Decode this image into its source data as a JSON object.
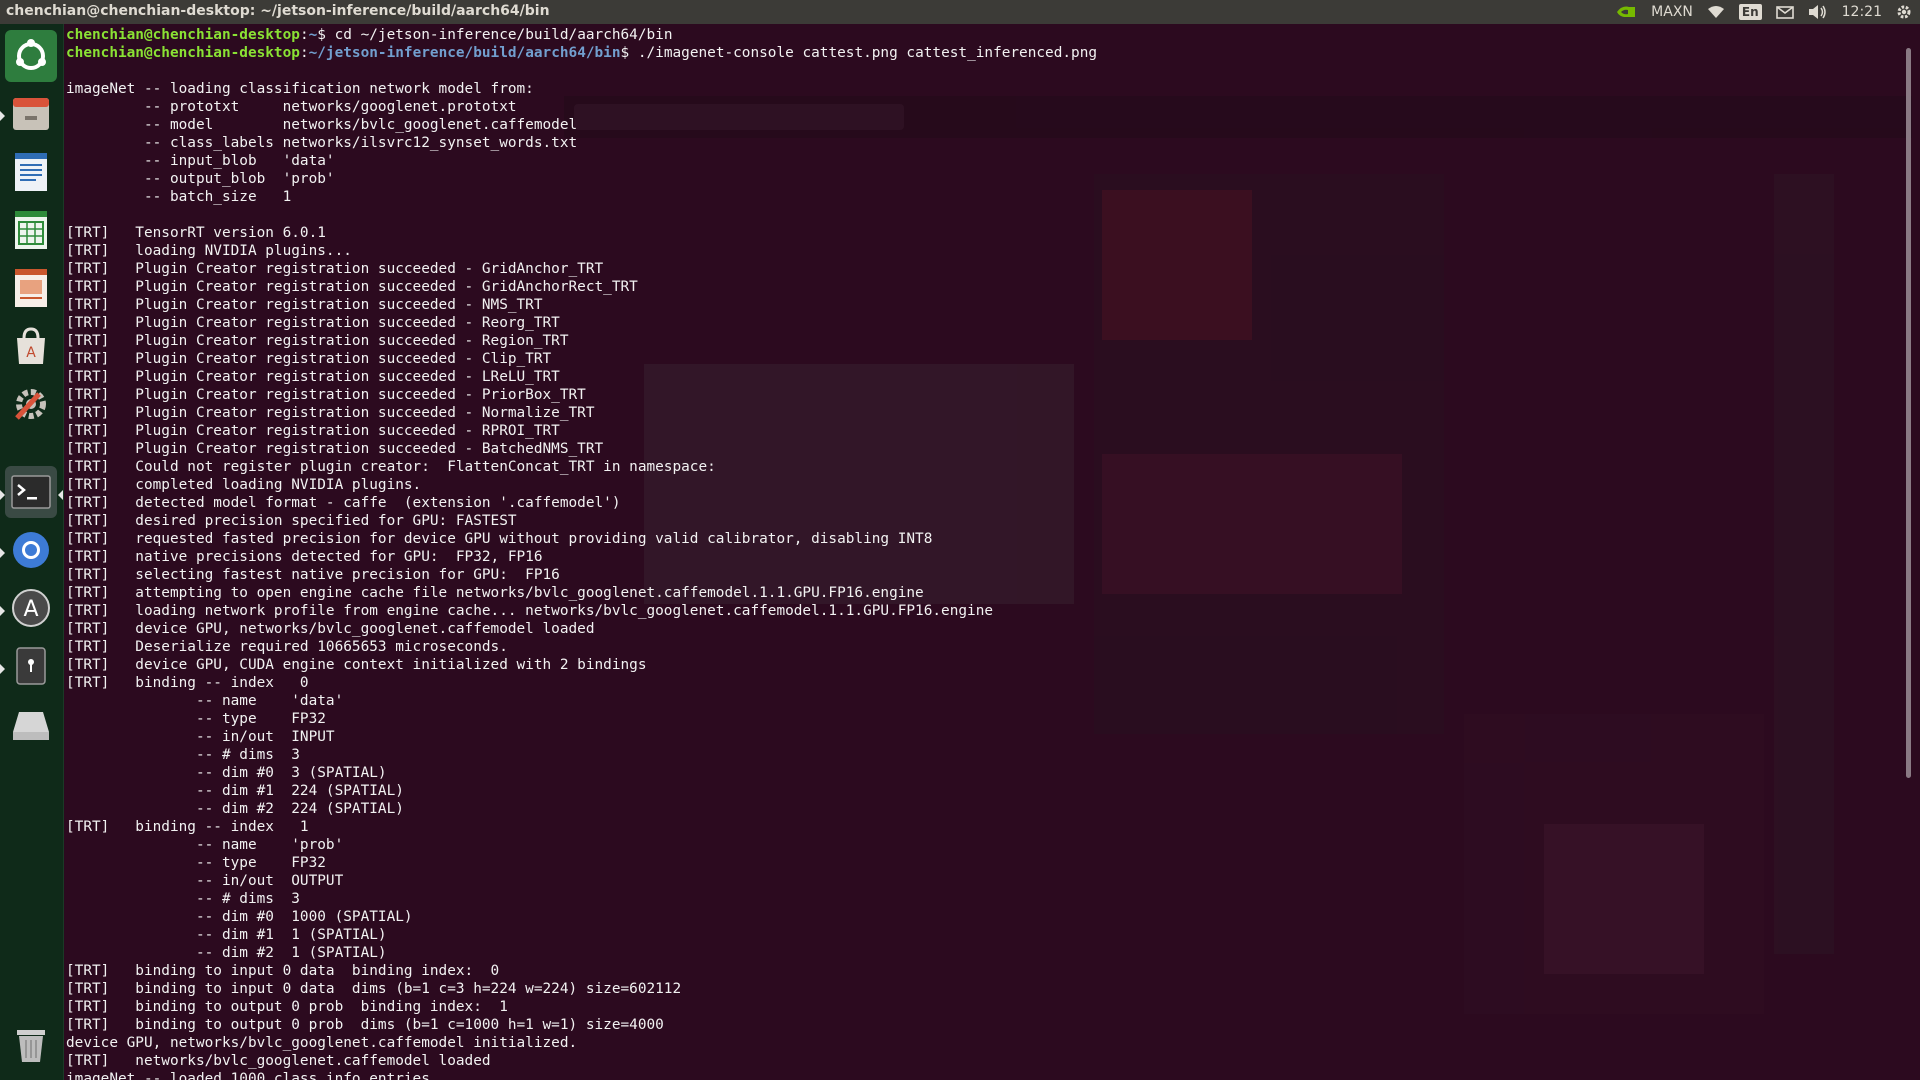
{
  "topbar": {
    "window_title": "chenchian@chenchian-desktop: ~/jetson-inference/build/aarch64/bin",
    "power_mode": "MAXN",
    "language": "En",
    "time": "12:21",
    "icons": [
      "nvidia-icon",
      "wifi-icon",
      "mail-icon",
      "volume-icon",
      "gear-icon"
    ]
  },
  "launcher": {
    "items": [
      {
        "name": "ubuntu-dash",
        "icon": "ubuntu-logo-icon"
      },
      {
        "name": "files",
        "icon": "file-manager-icon"
      },
      {
        "name": "writer",
        "icon": "writer-document-icon"
      },
      {
        "name": "calc",
        "icon": "spreadsheet-icon"
      },
      {
        "name": "impress",
        "icon": "presentation-icon"
      },
      {
        "name": "software",
        "icon": "shopping-bag-icon"
      },
      {
        "name": "settings",
        "icon": "system-settings-icon"
      },
      {
        "name": "terminal",
        "icon": "terminal-icon"
      },
      {
        "name": "chromium",
        "icon": "browser-icon"
      },
      {
        "name": "updater",
        "icon": "software-updater-icon"
      },
      {
        "name": "usb",
        "icon": "usb-drive-icon"
      },
      {
        "name": "drive",
        "icon": "removable-drive-icon"
      },
      {
        "name": "trash",
        "icon": "trash-icon"
      }
    ]
  },
  "terminal": {
    "prompt_user": "chenchian@chenchian-desktop",
    "prompt_sep": ":",
    "prompt_path_1": "~",
    "cmd_1": "$ cd ~/jetson-inference/build/aarch64/bin",
    "prompt_path_2": "~/jetson-inference/build/aarch64/bin",
    "cmd_2": "$ ./imagenet-console cattest.png cattest_inferenced.png",
    "output": [
      "",
      "imageNet -- loading classification network model from:",
      "         -- prototxt     networks/googlenet.prototxt",
      "         -- model        networks/bvlc_googlenet.caffemodel",
      "         -- class_labels networks/ilsvrc12_synset_words.txt",
      "         -- input_blob   'data'",
      "         -- output_blob  'prob'",
      "         -- batch_size   1",
      "",
      "[TRT]   TensorRT version 6.0.1",
      "[TRT]   loading NVIDIA plugins...",
      "[TRT]   Plugin Creator registration succeeded - GridAnchor_TRT",
      "[TRT]   Plugin Creator registration succeeded - GridAnchorRect_TRT",
      "[TRT]   Plugin Creator registration succeeded - NMS_TRT",
      "[TRT]   Plugin Creator registration succeeded - Reorg_TRT",
      "[TRT]   Plugin Creator registration succeeded - Region_TRT",
      "[TRT]   Plugin Creator registration succeeded - Clip_TRT",
      "[TRT]   Plugin Creator registration succeeded - LReLU_TRT",
      "[TRT]   Plugin Creator registration succeeded - PriorBox_TRT",
      "[TRT]   Plugin Creator registration succeeded - Normalize_TRT",
      "[TRT]   Plugin Creator registration succeeded - RPROI_TRT",
      "[TRT]   Plugin Creator registration succeeded - BatchedNMS_TRT",
      "[TRT]   Could not register plugin creator:  FlattenConcat_TRT in namespace:",
      "[TRT]   completed loading NVIDIA plugins.",
      "[TRT]   detected model format - caffe  (extension '.caffemodel')",
      "[TRT]   desired precision specified for GPU: FASTEST",
      "[TRT]   requested fasted precision for device GPU without providing valid calibrator, disabling INT8",
      "[TRT]   native precisions detected for GPU:  FP32, FP16",
      "[TRT]   selecting fastest native precision for GPU:  FP16",
      "[TRT]   attempting to open engine cache file networks/bvlc_googlenet.caffemodel.1.1.GPU.FP16.engine",
      "[TRT]   loading network profile from engine cache... networks/bvlc_googlenet.caffemodel.1.1.GPU.FP16.engine",
      "[TRT]   device GPU, networks/bvlc_googlenet.caffemodel loaded",
      "[TRT]   Deserialize required 10665653 microseconds.",
      "[TRT]   device GPU, CUDA engine context initialized with 2 bindings",
      "[TRT]   binding -- index   0",
      "               -- name    'data'",
      "               -- type    FP32",
      "               -- in/out  INPUT",
      "               -- # dims  3",
      "               -- dim #0  3 (SPATIAL)",
      "               -- dim #1  224 (SPATIAL)",
      "               -- dim #2  224 (SPATIAL)",
      "[TRT]   binding -- index   1",
      "               -- name    'prob'",
      "               -- type    FP32",
      "               -- in/out  OUTPUT",
      "               -- # dims  3",
      "               -- dim #0  1000 (SPATIAL)",
      "               -- dim #1  1 (SPATIAL)",
      "               -- dim #2  1 (SPATIAL)",
      "[TRT]   binding to input 0 data  binding index:  0",
      "[TRT]   binding to input 0 data  dims (b=1 c=3 h=224 w=224) size=602112",
      "[TRT]   binding to output 0 prob  binding index:  1",
      "[TRT]   binding to output 0 prob  dims (b=1 c=1000 h=1 w=1) size=4000",
      "device GPU, networks/bvlc_googlenet.caffemodel initialized.",
      "[TRT]   networks/bvlc_googlenet.caffemodel loaded",
      "imageNet -- loaded 1000 class info entries"
    ]
  },
  "colors": {
    "terminal_bg": "#2c0a1f",
    "prompt_user": "#8ae234",
    "prompt_path": "#729fcf",
    "text": "#f2f2f2",
    "launcher_bg": "#0f2a19",
    "topbar_bg": "#3c3b37"
  }
}
